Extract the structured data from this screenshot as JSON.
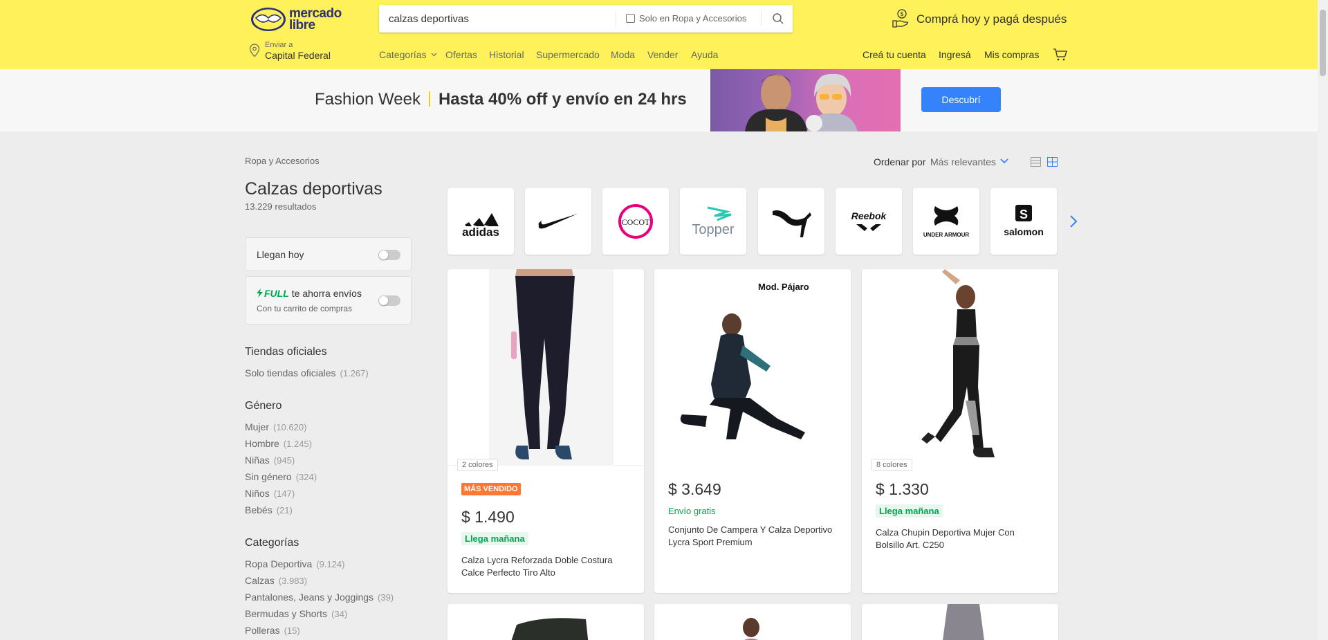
{
  "header": {
    "logo_text_line1": "mercado",
    "logo_text_line2": "libre",
    "search": {
      "value": "calzas deportivas",
      "checkbox_label": "Solo en Ropa y Accesorios"
    },
    "promo_text": "Comprá hoy y pagá después",
    "shipping": {
      "small": "Enviar a",
      "city": "Capital Federal"
    },
    "nav": [
      "Categorías",
      "Ofertas",
      "Historial",
      "Supermercado",
      "Moda",
      "Vender",
      "Ayuda"
    ],
    "account": [
      "Creá tu cuenta",
      "Ingresá",
      "Mis compras"
    ],
    "brand_color": "#fff159"
  },
  "banner": {
    "title": "Fashion Week",
    "highlight": "Hasta 40% off y envío en 24 hrs",
    "button": "Descubrí"
  },
  "breadcrumb": "Ropa y Accesorios",
  "page_title": "Calzas deportivas",
  "results": "13.229 resultados",
  "sort": {
    "label": "Ordenar por",
    "value": "Más relevantes"
  },
  "filters": {
    "llegan_hoy": "Llegan hoy",
    "full": {
      "brand": "FULL",
      "text": "te ahorra envíos",
      "sub": "Con tu carrito de compras"
    },
    "tiendas": {
      "title": "Tiendas oficiales",
      "items": [
        {
          "label": "Solo tiendas oficiales",
          "count": "(1.267)"
        }
      ]
    },
    "genero": {
      "title": "Género",
      "items": [
        {
          "label": "Mujer",
          "count": "(10.620)"
        },
        {
          "label": "Hombre",
          "count": "(1.245)"
        },
        {
          "label": "Niñas",
          "count": "(945)"
        },
        {
          "label": "Sin género",
          "count": "(324)"
        },
        {
          "label": "Niños",
          "count": "(147)"
        },
        {
          "label": "Bebés",
          "count": "(21)"
        }
      ]
    },
    "categorias": {
      "title": "Categorías",
      "items": [
        {
          "label": "Ropa Deportiva",
          "count": "(9.124)"
        },
        {
          "label": "Calzas",
          "count": "(3.983)"
        },
        {
          "label": "Pantalones, Jeans y Joggings",
          "count": "(39)"
        },
        {
          "label": "Bermudas y Shorts",
          "count": "(34)"
        },
        {
          "label": "Polleras",
          "count": "(15)"
        }
      ]
    }
  },
  "brands": [
    "adidas",
    "nike",
    "COCOT",
    "Topper",
    "puma",
    "Reebok",
    "UNDER ARMOUR",
    "salomon"
  ],
  "products": [
    {
      "colors": "2 colores",
      "badge": "MÁS VENDIDO",
      "price": "$ 1.490",
      "shipping": "Llega mañana",
      "title": "Calza Lycra Reforzada Doble Costura Calce Perfecto Tiro Alto"
    },
    {
      "overlay": "Mod. Pájaro",
      "price": "$ 3.649",
      "shipping": "Envío gratis",
      "title": "Conjunto De Campera Y Calza Deportivo Lycra Sport Premium"
    },
    {
      "colors": "8 colores",
      "price": "$ 1.330",
      "shipping": "Llega mañana",
      "title": "Calza Chupin Deportiva Mujer Con Bolsillo Art. C250"
    }
  ]
}
